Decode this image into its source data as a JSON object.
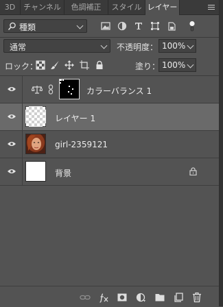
{
  "tabs": [
    "3D",
    "チャンネル",
    "色調補正",
    "スタイル",
    "レイヤー"
  ],
  "active_tab_index": 4,
  "filter": {
    "kind_label": "種類",
    "icons": [
      "pixel-filter-icon",
      "adjustment-filter-icon",
      "type-filter-icon",
      "shape-filter-icon",
      "smart-object-filter-icon",
      "filter-toggle-icon"
    ]
  },
  "blend": {
    "mode_label": "通常",
    "opacity_label": "不透明度：",
    "opacity_value": "100%"
  },
  "lock": {
    "label": "ロック：",
    "fill_label": "塗り：",
    "fill_value": "100%"
  },
  "layers": [
    {
      "name": "カラーバランス 1",
      "type": "adjustment",
      "visible": true,
      "selected": false
    },
    {
      "name": "レイヤー 1",
      "type": "transparent",
      "visible": true,
      "selected": true
    },
    {
      "name": "girl-2359121",
      "type": "photo",
      "visible": true,
      "selected": false
    },
    {
      "name": "背景",
      "type": "background",
      "visible": true,
      "selected": false,
      "locked": true
    }
  ],
  "colors": {
    "panel_bg": "#535353",
    "tab_bar_bg": "#3a3a3a",
    "selected_layer_bg": "#6a6a6a",
    "field_bg": "#434343",
    "text": "#e6e6e6"
  },
  "bottom_icons": [
    "link-layers-icon",
    "fx-icon",
    "layer-mask-icon",
    "new-adjustment-icon",
    "new-group-icon",
    "new-layer-icon",
    "trash-icon"
  ]
}
